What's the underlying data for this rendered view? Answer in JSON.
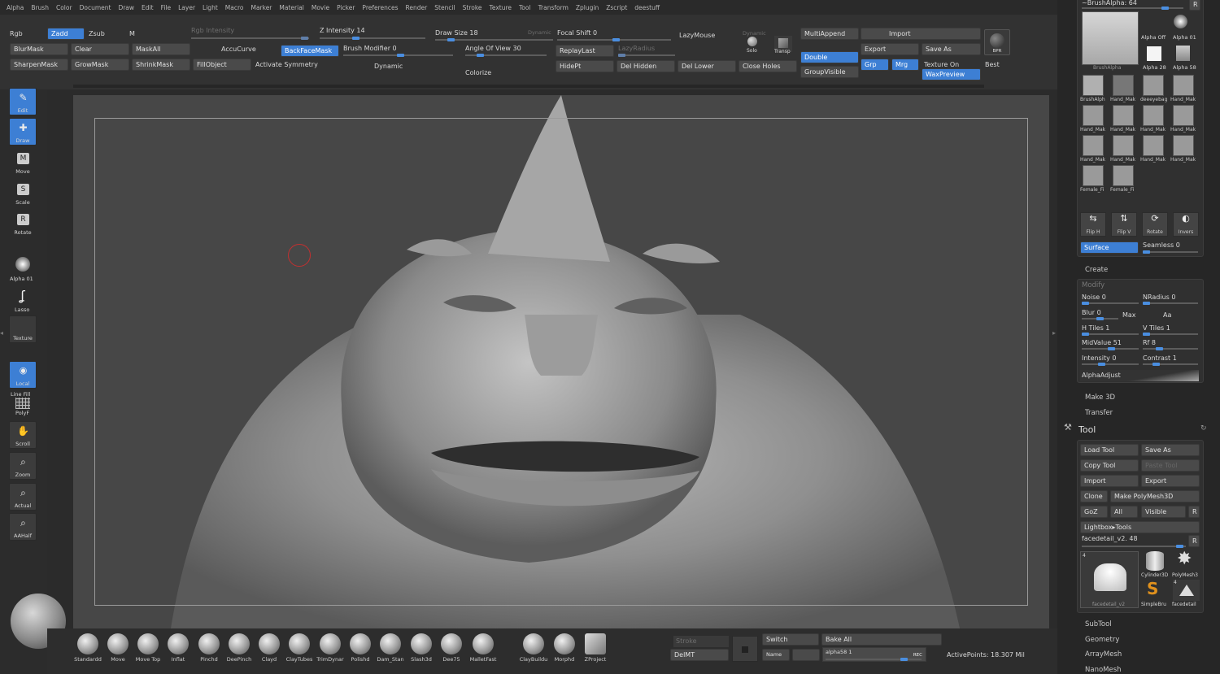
{
  "menu": [
    "Alpha",
    "Brush",
    "Color",
    "Document",
    "Draw",
    "Edit",
    "File",
    "Layer",
    "Light",
    "Macro",
    "Marker",
    "Material",
    "Movie",
    "Picker",
    "Preferences",
    "Render",
    "Stencil",
    "Stroke",
    "Texture",
    "Tool",
    "Transform",
    "Zplugin",
    "Zscript",
    "deestuff"
  ],
  "shelf": {
    "rgb": "Rgb",
    "zadd": "Zadd",
    "zsub": "Zsub",
    "m": "M",
    "rgb_intensity": "Rgb Intensity",
    "z_intensity": "Z Intensity 14",
    "draw_size": "Draw Size 18",
    "dynamic_small": "Dynamic",
    "focal_shift": "Focal Shift 0",
    "lazymouse": "LazyMouse",
    "dynamic_small2": "Dynamic",
    "solo": "Solo",
    "transp": "Transp",
    "multiappend": "MultiAppend",
    "import": "Import",
    "blurmask": "BlurMask",
    "clear": "Clear",
    "maskall": "MaskAll",
    "accucurve": "AccuCurve",
    "backfacemask": "BackFaceMask",
    "brush_modifier": "Brush Modifier 0",
    "angle_of_view": "Angle Of View 30",
    "replaylast": "ReplayLast",
    "lazyradius": "LazyRadius",
    "double": "Double",
    "export": "Export",
    "save_as": "Save As",
    "sharpenmask": "SharpenMask",
    "growmask": "GrowMask",
    "shrinkmask": "ShrinkMask",
    "fillobject": "FillObject",
    "activate_symmetry": "Activate Symmetry",
    "dynamic": "Dynamic",
    "colorize": "Colorize",
    "hidept": "HidePt",
    "del_hidden": "Del Hidden",
    "del_lower": "Del Lower",
    "close_holes": "Close Holes",
    "grp": "Grp",
    "mrg": "Mrg",
    "groupvisible": "GroupVisible",
    "texture_on": "Texture On",
    "best": "Best",
    "waxpreview": "WaxPreview",
    "bpr": "BPR"
  },
  "left_tools": [
    {
      "label": "Edit",
      "icon": "✎",
      "active": true
    },
    {
      "label": "Draw",
      "icon": "✚",
      "active": true
    },
    {
      "label": "Move",
      "icon": "M",
      "active": false
    },
    {
      "label": "Scale",
      "icon": "S",
      "active": false
    },
    {
      "label": "Rotate",
      "icon": "R",
      "active": false
    }
  ],
  "left_misc": {
    "alpha": "Alpha 01",
    "lasso": "Lasso",
    "texture": "Texture",
    "local": "Local",
    "linefill": "Line Fill",
    "polyf": "PolyF",
    "scroll": "Scroll",
    "zoom": "Zoom",
    "actual": "Actual",
    "aahalf": "AAHalf"
  },
  "brushes": [
    "Standardd",
    "Move",
    "Move Top",
    "Inflat",
    "Pinchd",
    "DeePinch",
    "Clayd",
    "ClayTubes",
    "TrimDynar",
    "Polishd",
    "Dam_Stan",
    "Slash3d",
    "Dee75",
    "MalletFast",
    "ClayBuildu",
    "Morphd",
    "ZProject"
  ],
  "bottom": {
    "stroke": "Stroke",
    "delmt": "DelMT",
    "switch": "Switch",
    "bake_all": "Bake All",
    "name": "Name",
    "alpha_field": "alpha58 1",
    "rec": "REC",
    "active_points": "ActivePoints: 18.307 Mil"
  },
  "right": {
    "title": "~BrushAlpha: 64",
    "r": "R",
    "alpha_off": "Alpha Off",
    "alpha_01": "Alpha 01",
    "alpha_28": "Alpha 28",
    "alpha_58": "Alpha 58",
    "brushalpha": "BrushAlpha",
    "thumbs": [
      "BrushAlph",
      "Hand_Mak",
      "deeeyebag",
      "Hand_Mak",
      "Hand_Mak",
      "Hand_Mak",
      "Hand_Mak",
      "Hand_Mak",
      "Hand_Mak",
      "Hand_Mak",
      "Hand_Mak",
      "Hand_Mak",
      "Female_Fi",
      "Female_Fi"
    ],
    "flip_h": "Flip H",
    "flip_v": "Flip V",
    "rotate": "Rotate",
    "invers": "Invers",
    "surface": "Surface",
    "seamless": "Seamless 0",
    "create": "Create",
    "modify": "Modify",
    "noise": "Noise 0",
    "nradius": "NRadius 0",
    "blur": "Blur 0",
    "max": "Max",
    "aa": "Aa",
    "htiles": "H Tiles 1",
    "vtiles": "V Tiles 1",
    "midvalue": "MidValue 51",
    "rf": "Rf 8",
    "intensity": "Intensity 0",
    "contrast": "Contrast 1",
    "alphaadjust": "AlphaAdjust",
    "make3d": "Make 3D",
    "transfer": "Transfer",
    "tool": "Tool",
    "load_tool": "Load Tool",
    "save_as": "Save As",
    "copy_tool": "Copy Tool",
    "paste_tool": "Paste Tool",
    "import": "Import",
    "export": "Export",
    "clone": "Clone",
    "make_polymesh": "Make PolyMesh3D",
    "goz": "GoZ",
    "all": "All",
    "visible": "Visible",
    "r2": "R",
    "lightbox_tools": "Lightbox▸Tools",
    "current_tool": "facedetail_v2. 48",
    "tool_count": "4",
    "tool_count2": "4",
    "cylinder": "Cylinder3D",
    "polymesh": "PolyMesh3",
    "simplebrush": "SimpleBru",
    "facedetail": "facedetail",
    "facedetail_main": "facedetail_v2",
    "subtool": "SubTool",
    "geometry": "Geometry",
    "arraymesh": "ArrayMesh",
    "nanomesh": "NanoMesh"
  }
}
